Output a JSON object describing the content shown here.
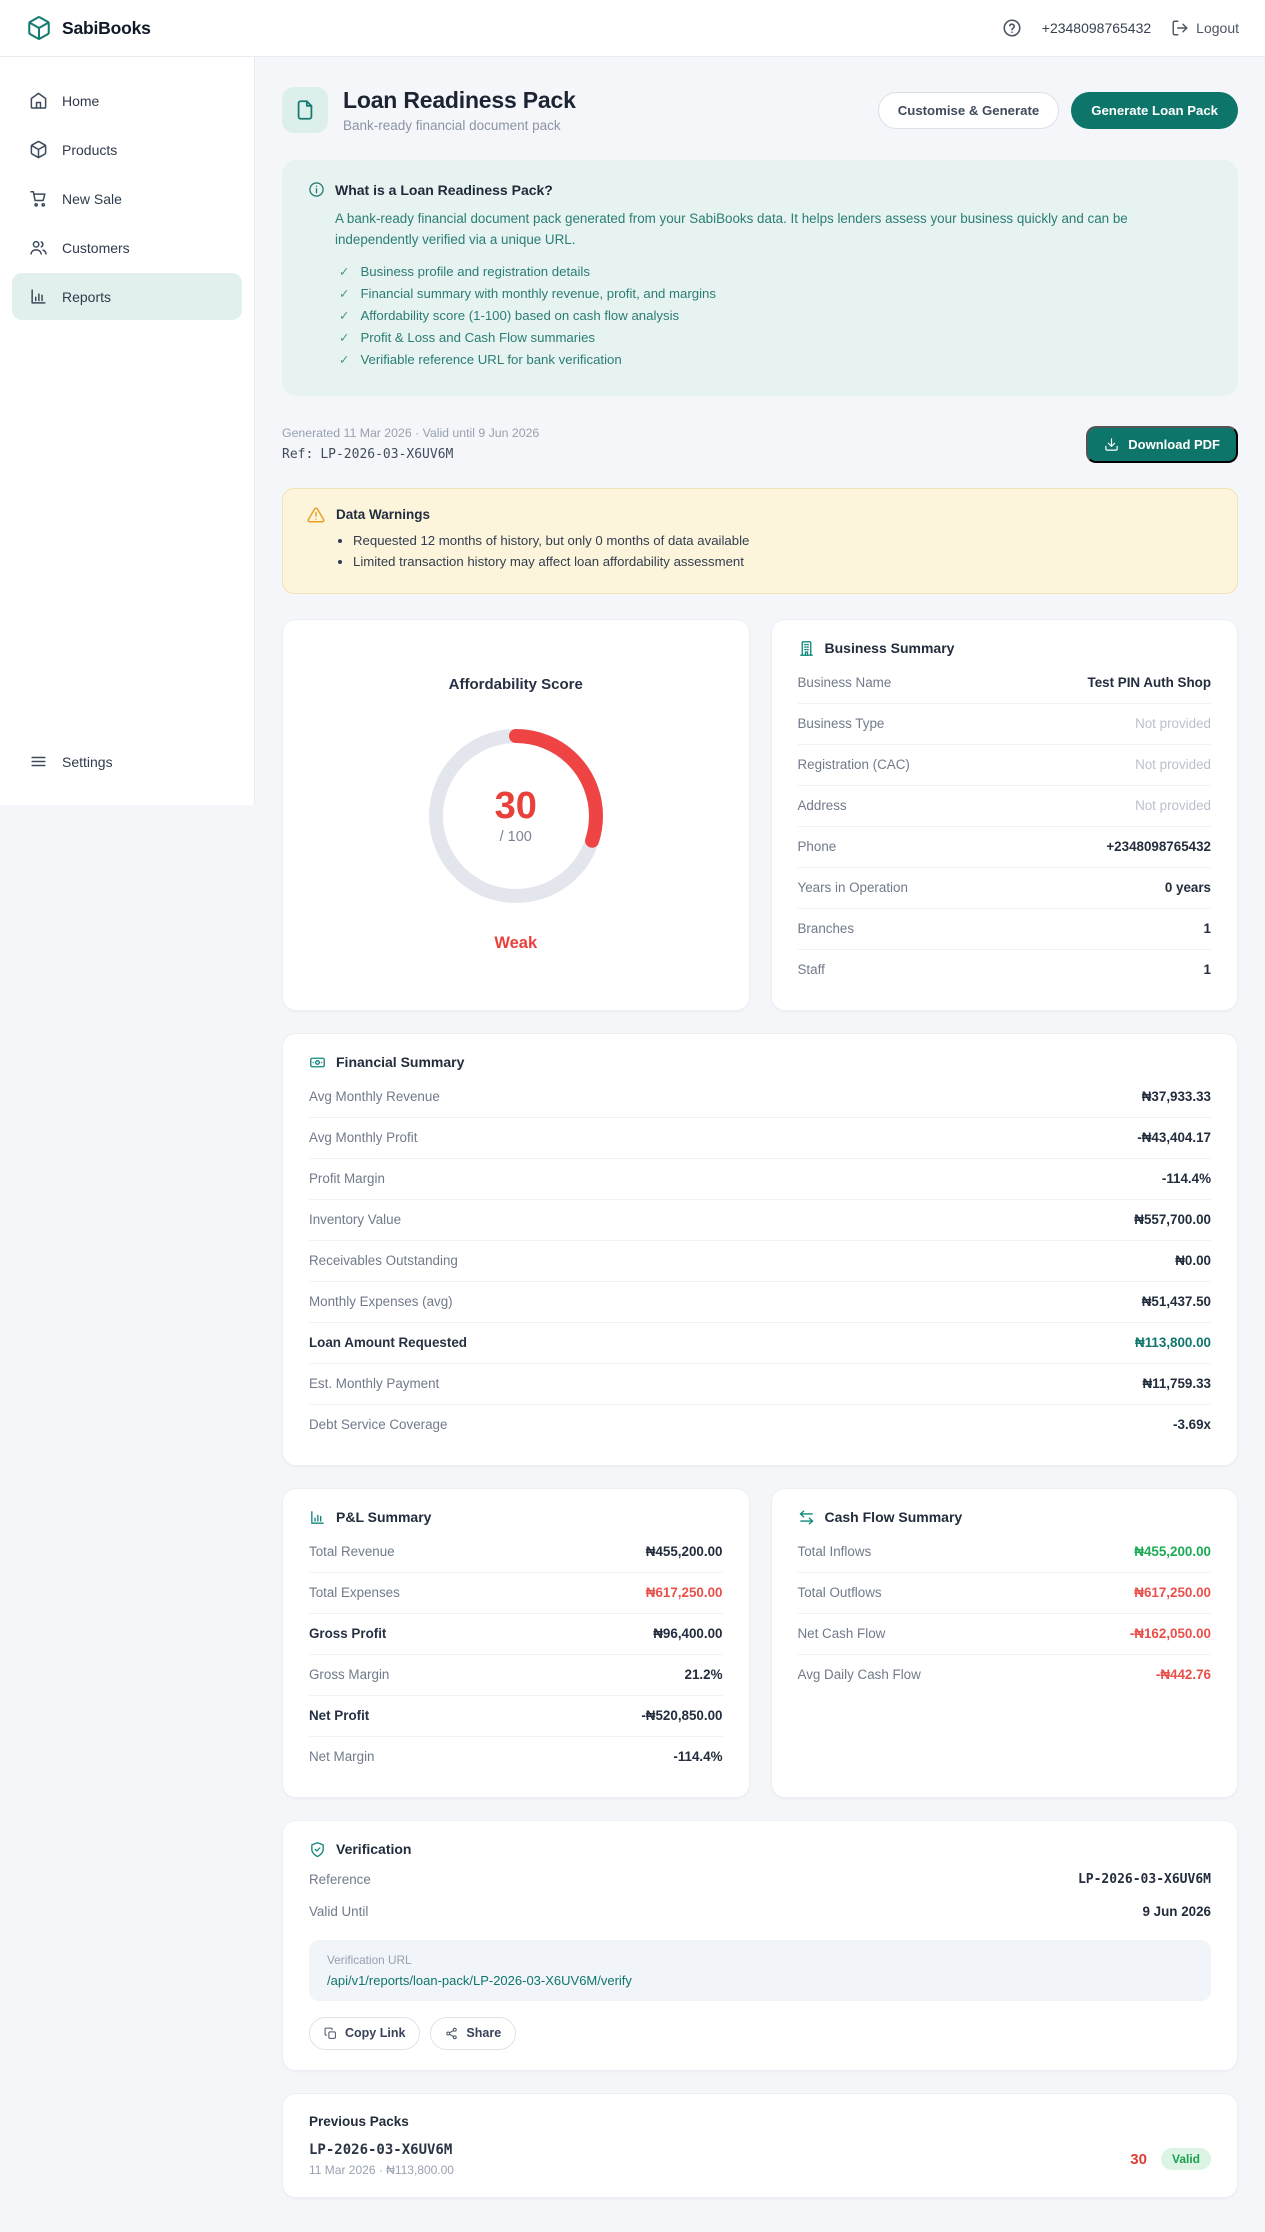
{
  "header": {
    "brand": "SabiBooks",
    "phone": "+2348098765432",
    "logout_label": "Logout"
  },
  "sidebar": {
    "items": [
      {
        "label": "Home",
        "icon": "home-icon",
        "active": false
      },
      {
        "label": "Products",
        "icon": "box-icon",
        "active": false
      },
      {
        "label": "New Sale",
        "icon": "cart-icon",
        "active": false
      },
      {
        "label": "Customers",
        "icon": "users-icon",
        "active": false
      },
      {
        "label": "Reports",
        "icon": "chart-icon",
        "active": true
      }
    ],
    "settings": {
      "label": "Settings",
      "icon": "menu-icon"
    }
  },
  "page": {
    "title": "Loan Readiness Pack",
    "subtitle": "Bank-ready financial document pack",
    "customise_button": "Customise & Generate",
    "generate_button": "Generate Loan Pack"
  },
  "info_box": {
    "title": "What is a Loan Readiness Pack?",
    "description": "A bank-ready financial document pack generated from your SabiBooks data. It helps lenders assess your business quickly and can be independently verified via a unique URL.",
    "bullets": [
      "Business profile and registration details",
      "Financial summary with monthly revenue, profit, and margins",
      "Affordability score (1-100) based on cash flow analysis",
      "Profit & Loss and Cash Flow summaries",
      "Verifiable reference URL for bank verification"
    ]
  },
  "meta": {
    "generated_line": "Generated 11 Mar 2026 · Valid until 9 Jun 2026",
    "ref_label": "Ref:",
    "ref_value": "LP-2026-03-X6UV6M",
    "download_button": "Download PDF"
  },
  "warnings": {
    "title": "Data Warnings",
    "items": [
      "Requested 12 months of history, but only 0 months of data available",
      "Limited transaction history may affect loan affordability assessment"
    ]
  },
  "affordability": {
    "title": "Affordability Score",
    "score": "30",
    "denominator": "/ 100",
    "rating": "Weak",
    "percent": 30,
    "arc_color": "#ef4444",
    "track_color": "#e3e6ed"
  },
  "business_summary": {
    "title": "Business Summary",
    "rows": [
      {
        "label": "Business Name",
        "value": "Test PIN Auth Shop"
      },
      {
        "label": "Business Type",
        "value": "Not provided",
        "tone": "muted"
      },
      {
        "label": "Registration (CAC)",
        "value": "Not provided",
        "tone": "muted"
      },
      {
        "label": "Address",
        "value": "Not provided",
        "tone": "muted"
      },
      {
        "label": "Phone",
        "value": "+2348098765432"
      },
      {
        "label": "Years in Operation",
        "value": "0 years"
      },
      {
        "label": "Branches",
        "value": "1"
      },
      {
        "label": "Staff",
        "value": "1"
      }
    ]
  },
  "financial_summary": {
    "title": "Financial Summary",
    "rows": [
      {
        "label": "Avg Monthly Revenue",
        "value": "₦37,933.33"
      },
      {
        "label": "Avg Monthly Profit",
        "value": "-₦43,404.17"
      },
      {
        "label": "Profit Margin",
        "value": "-114.4%"
      },
      {
        "label": "Inventory Value",
        "value": "₦557,700.00"
      },
      {
        "label": "Receivables Outstanding",
        "value": "₦0.00"
      },
      {
        "label": "Monthly Expenses (avg)",
        "value": "₦51,437.50"
      },
      {
        "label": "Loan Amount Requested",
        "value": "₦113,800.00",
        "bold": true,
        "tone": "teal"
      },
      {
        "label": "Est. Monthly Payment",
        "value": "₦11,759.33"
      },
      {
        "label": "Debt Service Coverage",
        "value": "-3.69x"
      }
    ]
  },
  "pl_summary": {
    "title": "P&L Summary",
    "rows": [
      {
        "label": "Total Revenue",
        "value": "₦455,200.00"
      },
      {
        "label": "Total Expenses",
        "value": "₦617,250.00",
        "tone": "red"
      },
      {
        "label": "Gross Profit",
        "value": "₦96,400.00",
        "bold": true
      },
      {
        "label": "Gross Margin",
        "value": "21.2%"
      },
      {
        "label": "Net Profit",
        "value": "-₦520,850.00",
        "bold": true
      },
      {
        "label": "Net Margin",
        "value": "-114.4%"
      }
    ]
  },
  "cashflow_summary": {
    "title": "Cash Flow Summary",
    "rows": [
      {
        "label": "Total Inflows",
        "value": "₦455,200.00",
        "tone": "green"
      },
      {
        "label": "Total Outflows",
        "value": "₦617,250.00",
        "tone": "red"
      },
      {
        "label": "Net Cash Flow",
        "value": "-₦162,050.00",
        "tone": "red"
      },
      {
        "label": "Avg Daily Cash Flow",
        "value": "-₦442.76",
        "tone": "red"
      }
    ]
  },
  "verification": {
    "title": "Verification",
    "rows": [
      {
        "label": "Reference",
        "value": "LP-2026-03-X6UV6M",
        "tone": "mono"
      },
      {
        "label": "Valid Until",
        "value": "9 Jun 2026"
      }
    ],
    "url_label": "Verification URL",
    "url": "/api/v1/reports/loan-pack/LP-2026-03-X6UV6M/verify",
    "copy_button": "Copy Link",
    "share_button": "Share"
  },
  "previous_packs": {
    "title": "Previous Packs",
    "packs": [
      {
        "ref": "LP-2026-03-X6UV6M",
        "meta": "11 Mar 2026 · ₦113,800.00",
        "score": "30",
        "status": "Valid"
      }
    ]
  },
  "colors": {
    "accent": "#0f766e",
    "danger": "#ef4444",
    "success": "#16a34a",
    "warning": "#f59e0b"
  }
}
